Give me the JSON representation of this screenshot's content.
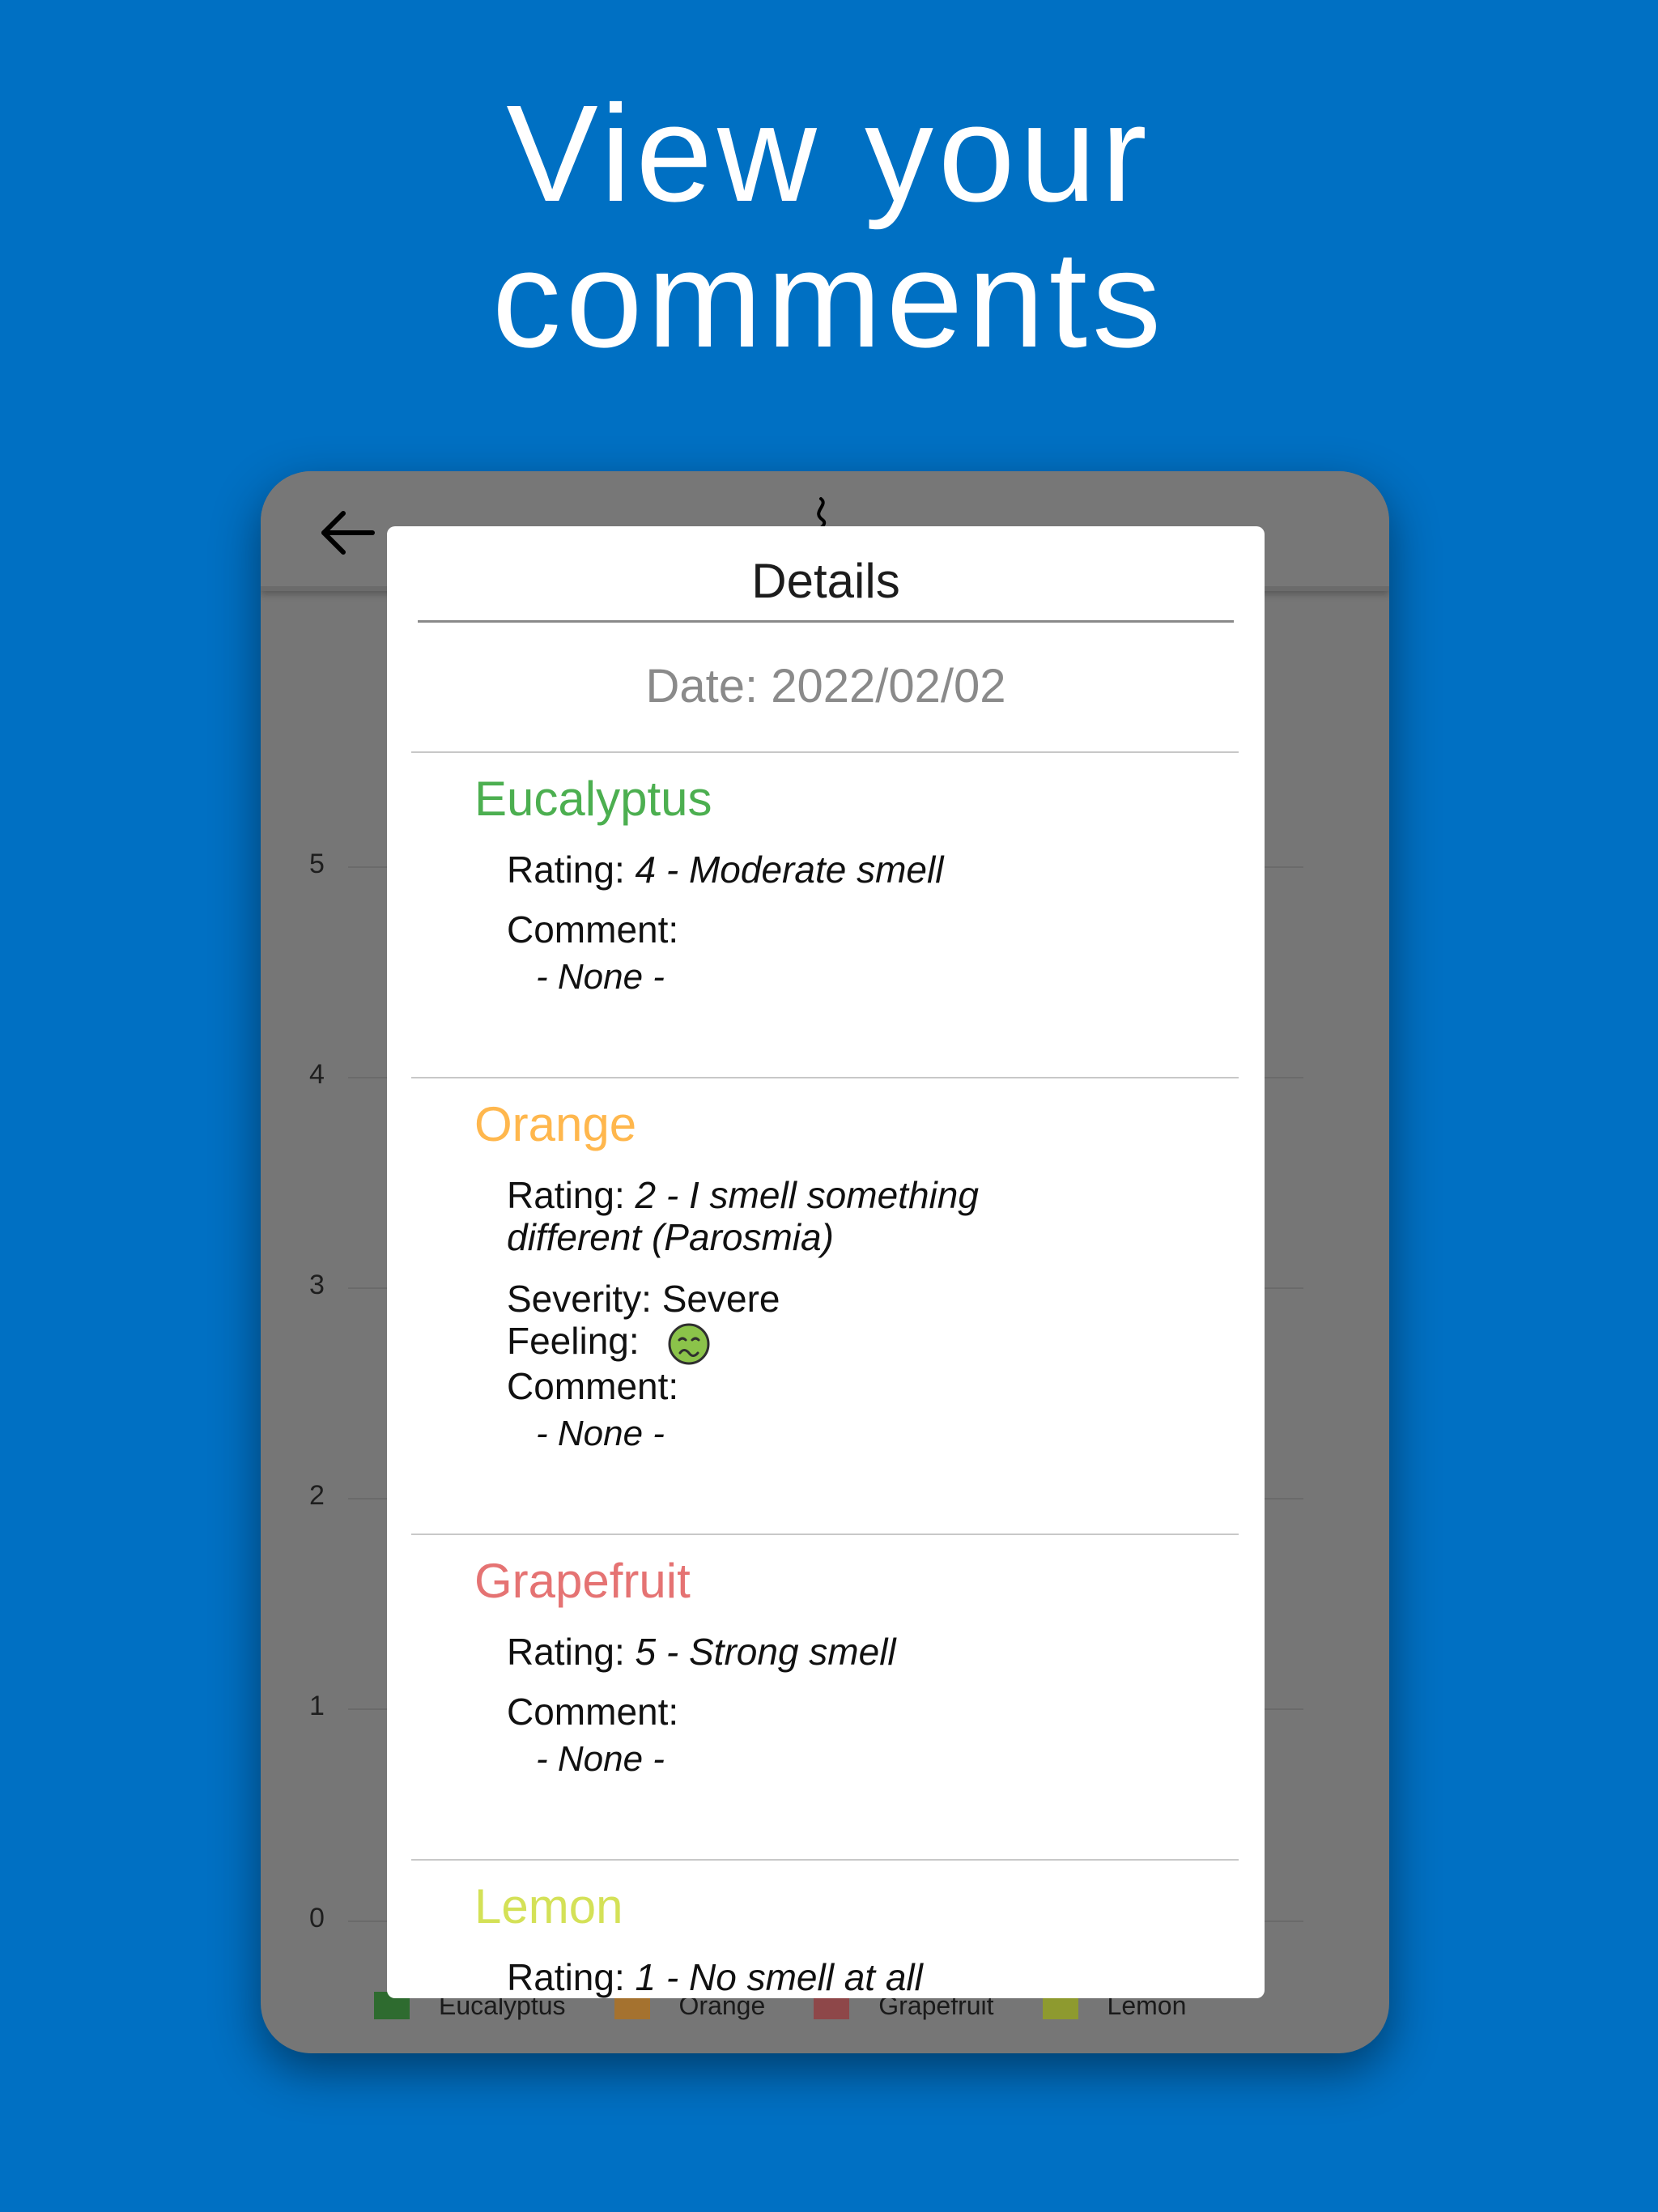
{
  "headline": {
    "line1": "View your",
    "line2": "comments"
  },
  "chart": {
    "yticks": [
      "5",
      "4",
      "3",
      "2",
      "1",
      "0"
    ],
    "legend": [
      {
        "label": "Eucalyptus",
        "color": "#2E6B2F"
      },
      {
        "label": "Orange",
        "color": "#A5722F"
      },
      {
        "label": "Grapefruit",
        "color": "#8E4749"
      },
      {
        "label": "Lemon",
        "color": "#8E9A2F"
      }
    ]
  },
  "details": {
    "title": "Details",
    "date": "Date: 2022/02/02",
    "entries": [
      {
        "name": "Eucalyptus",
        "color": "#4CAF50",
        "rating_label": "Rating:",
        "rating_value": "4 - Moderate smell",
        "comment_label": "Comment:",
        "comment_value": "- None -"
      },
      {
        "name": "Orange",
        "color": "#FFB74D",
        "rating_label": "Rating:",
        "rating_value_line1": "2 - I smell something",
        "rating_value_line2": "different (Parosmia)",
        "severity": "Severity: Severe",
        "feeling_label": "Feeling:",
        "feeling_icon": "nauseated-face-icon",
        "comment_label": "Comment:",
        "comment_value": "- None -"
      },
      {
        "name": "Grapefruit",
        "color": "#E57373",
        "rating_label": "Rating:",
        "rating_value": "5 - Strong smell",
        "comment_label": "Comment:",
        "comment_value": "- None -"
      },
      {
        "name": "Lemon",
        "color": "#D4E157",
        "rating_label": "Rating:",
        "rating_value": "1 - No smell at all"
      }
    ]
  }
}
